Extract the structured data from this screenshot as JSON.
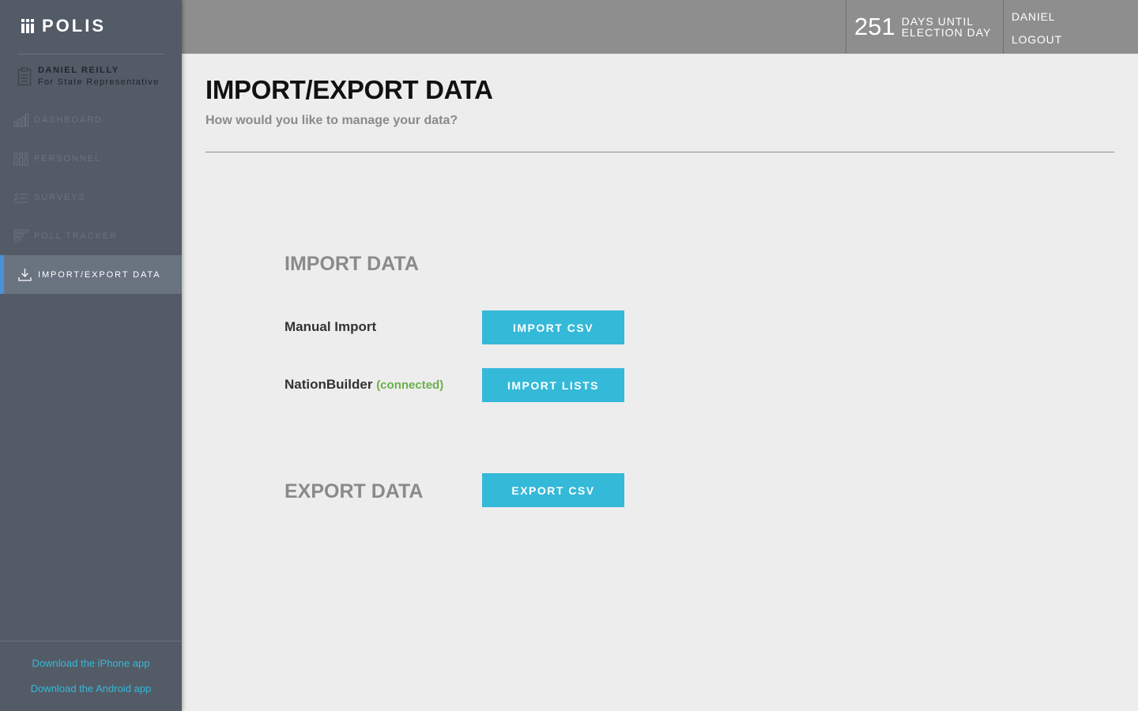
{
  "brand": {
    "name": "POLIS"
  },
  "candidate": {
    "name": "DANIEL REILLY",
    "role": "For State Representative"
  },
  "nav": {
    "items": [
      {
        "label": "DASHBOARD",
        "icon": "bar-chart-icon"
      },
      {
        "label": "PERSONNEL",
        "icon": "people-icon"
      },
      {
        "label": "SURVEYS",
        "icon": "checklist-icon"
      },
      {
        "label": "POLL TRACKER",
        "icon": "poll-icon"
      },
      {
        "label": "IMPORT/EXPORT DATA",
        "icon": "download-icon",
        "active": true
      }
    ]
  },
  "footer": {
    "iphone": "Download the iPhone app",
    "android": "Download the Android app"
  },
  "header": {
    "days_count": "251",
    "days_line1": "DAYS UNTIL",
    "days_line2": "ELECTION DAY",
    "user": "DANIEL",
    "logout": "LOGOUT"
  },
  "main": {
    "title": "IMPORT/EXPORT DATA",
    "subtitle": "How would you like to manage your data?",
    "import_section": "IMPORT DATA",
    "manual_import_label": "Manual Import",
    "import_csv_button": "IMPORT CSV",
    "nationbuilder_label": "NationBuilder",
    "nationbuilder_status": "(connected)",
    "import_lists_button": "IMPORT LISTS",
    "export_section": "EXPORT DATA",
    "export_csv_button": "EXPORT CSV"
  },
  "colors": {
    "sidebar_bg": "#535b67",
    "topbar_bg": "#8e8e8e",
    "accent": "#35b9d8",
    "connected": "#6ab04c",
    "active_marker": "#4a90d9"
  }
}
